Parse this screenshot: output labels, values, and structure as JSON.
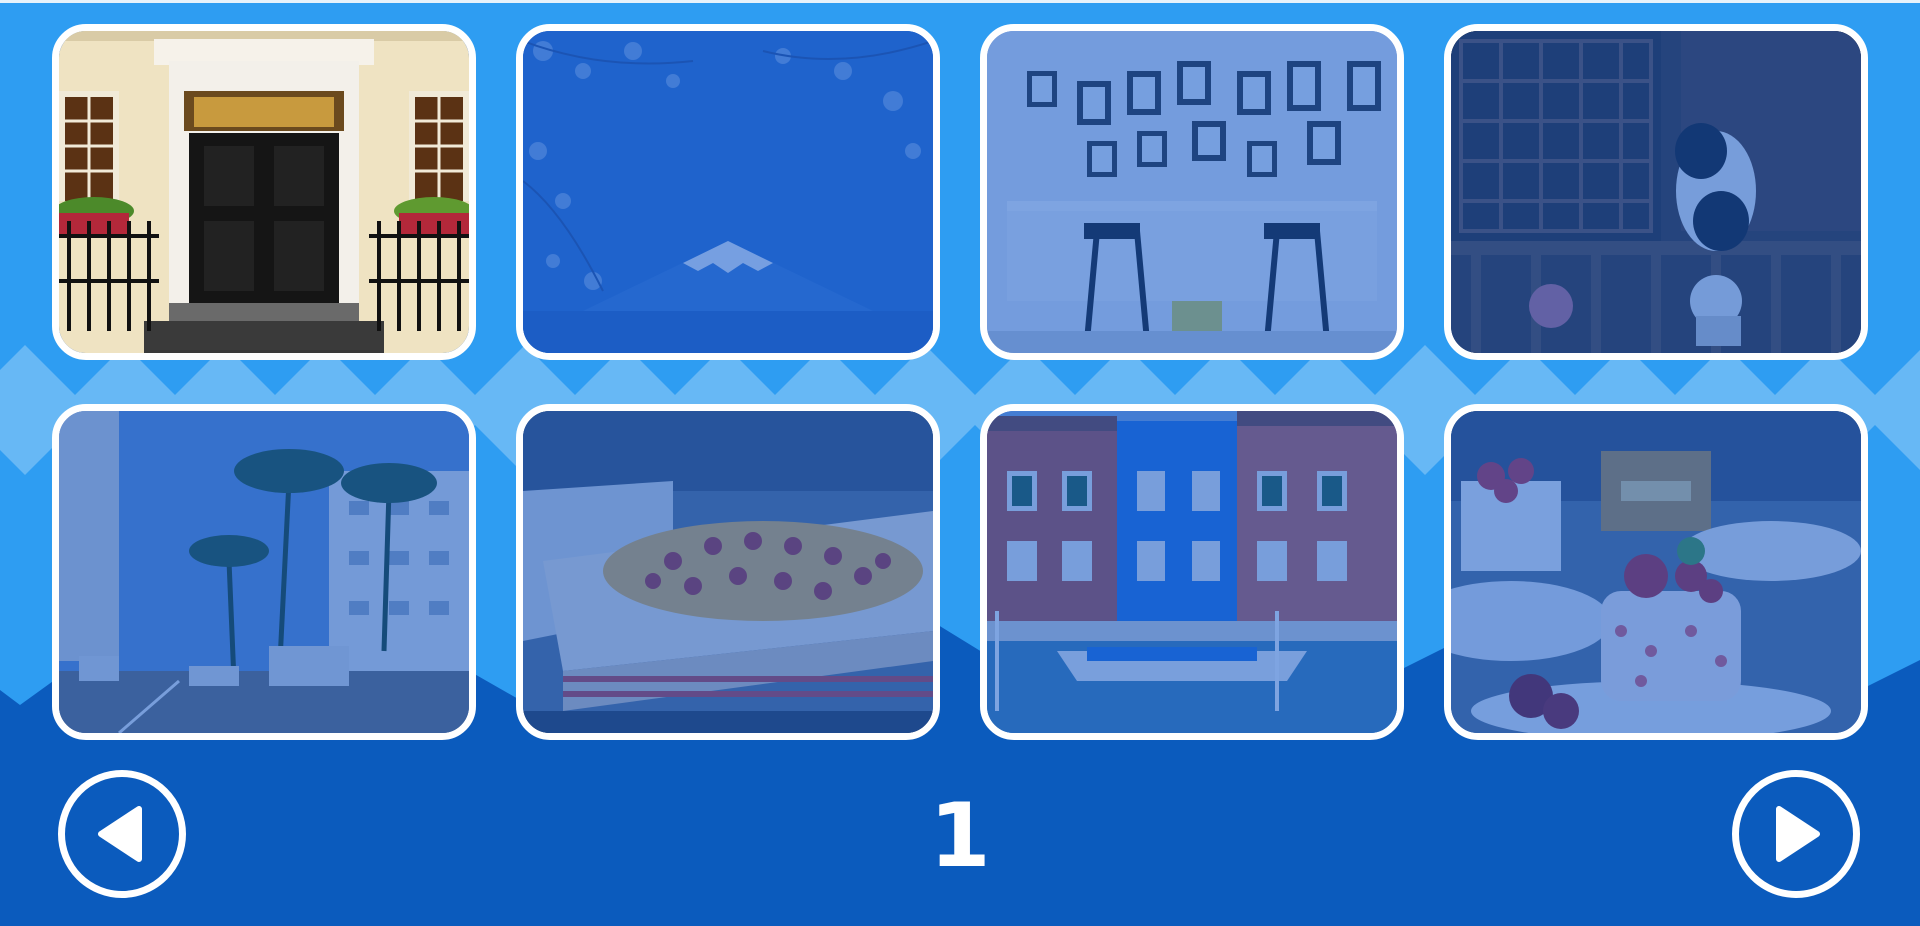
{
  "colors": {
    "sky": "#2e9df2",
    "chevron_light": "#67b8f5",
    "ground": "#0b5bbd",
    "tile_border": "#ffffff",
    "tile_shade": "#145ac8"
  },
  "pagination": {
    "current_page": "1",
    "prev_icon": "left-triangle-icon",
    "next_icon": "right-triangle-icon"
  },
  "tiles": [
    {
      "subject": "georgian-door",
      "active": true
    },
    {
      "subject": "mount-fuji-cherry-blossom",
      "active": false
    },
    {
      "subject": "cafe-interior-bar-stools",
      "active": false
    },
    {
      "subject": "dog-on-balcony",
      "active": false
    },
    {
      "subject": "palm-tree-street",
      "active": false
    },
    {
      "subject": "pizza-in-box",
      "active": false
    },
    {
      "subject": "colorful-canal-houses",
      "active": false
    },
    {
      "subject": "strawberry-cakes",
      "active": false
    }
  ]
}
